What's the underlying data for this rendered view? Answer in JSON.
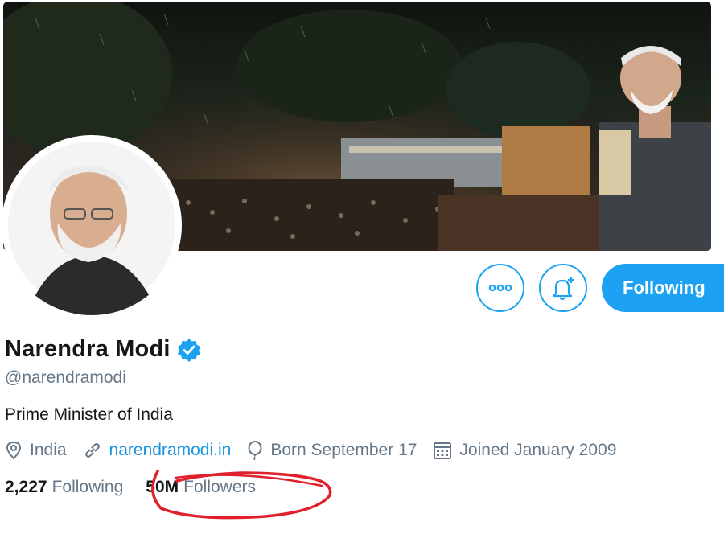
{
  "profile": {
    "name": "Narendra Modi",
    "handle": "@narendramodi",
    "bio": "Prime Minister of India",
    "verified": true
  },
  "actions": {
    "follow_label": "Following"
  },
  "meta": {
    "location": "India",
    "website": "narendramodi.in",
    "birthday": "Born September 17",
    "joined": "Joined January 2009"
  },
  "stats": {
    "following_count": "2,227",
    "following_label": "Following",
    "followers_count": "50M",
    "followers_label": "Followers"
  },
  "icons": {
    "more": "more-dots-icon",
    "notify": "bell-plus-icon",
    "location": "location-pin-icon",
    "website": "link-icon",
    "birthday": "balloon-icon",
    "joined": "calendar-icon",
    "verified": "verified-badge-icon"
  },
  "colors": {
    "accent": "#1da1f2",
    "link": "#1b95e0",
    "secondary_text": "#657786",
    "annotation": "#e0202a"
  }
}
